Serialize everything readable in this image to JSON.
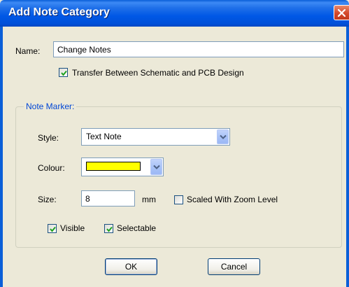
{
  "window": {
    "title": "Add Note Category"
  },
  "name_field": {
    "label": "Name:",
    "value": "Change Notes"
  },
  "transfer_checkbox": {
    "label": "Transfer Between Schematic and PCB Design",
    "checked": true
  },
  "note_marker": {
    "legend": "Note Marker:",
    "style": {
      "label": "Style:",
      "value": "Text Note"
    },
    "colour": {
      "label": "Colour:",
      "value": "#ffff00"
    },
    "size": {
      "label": "Size:",
      "value": "8",
      "unit": "mm"
    },
    "scaled_checkbox": {
      "label": "Scaled With Zoom Level",
      "checked": false
    },
    "visible_checkbox": {
      "label": "Visible",
      "checked": true
    },
    "selectable_checkbox": {
      "label": "Selectable",
      "checked": true
    }
  },
  "buttons": {
    "ok": "OK",
    "cancel": "Cancel"
  },
  "colors": {
    "titlebar": "#0058e6",
    "dialog_bg": "#ece9d8",
    "group_legend": "#0046d5",
    "checkmark": "#21a121"
  },
  "icons": {
    "close": "close-icon",
    "check": "checkmark-icon",
    "dropdown": "chevron-down-icon"
  }
}
